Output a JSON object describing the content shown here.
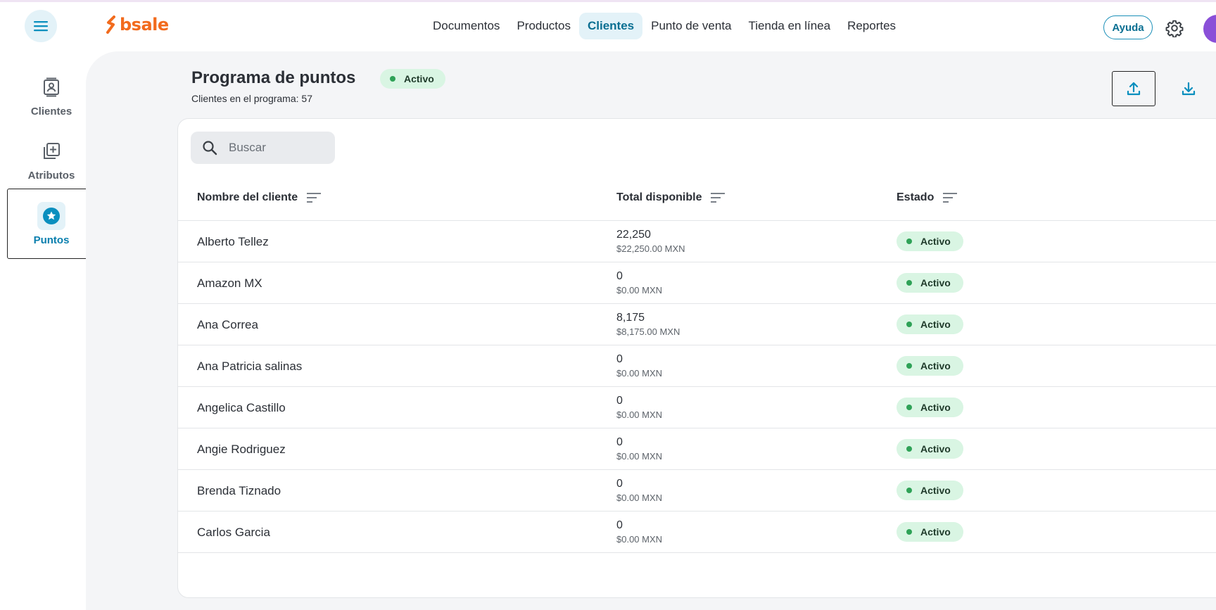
{
  "header": {
    "logo_text": "bsale",
    "nav": [
      {
        "label": "Documentos",
        "active": false
      },
      {
        "label": "Productos",
        "active": false
      },
      {
        "label": "Clientes",
        "active": true
      },
      {
        "label": "Punto de venta",
        "active": false
      },
      {
        "label": "Tienda en línea",
        "active": false
      },
      {
        "label": "Reportes",
        "active": false
      }
    ],
    "help_label": "Ayuda"
  },
  "sidebar": {
    "items": [
      {
        "label": "Clientes",
        "icon": "contact-card-icon",
        "active": false
      },
      {
        "label": "Atributos",
        "icon": "add-library-icon",
        "active": false
      },
      {
        "label": "Puntos",
        "icon": "star-icon",
        "active": true
      }
    ]
  },
  "page": {
    "title": "Programa de puntos",
    "status_badge": "Activo",
    "subtitle": "Clientes en el programa: 57"
  },
  "search": {
    "placeholder": "Buscar"
  },
  "table": {
    "columns": [
      "Nombre del cliente",
      "Total disponible",
      "Estado"
    ],
    "rows": [
      {
        "name": "Alberto Tellez",
        "points": "22,250",
        "money": "$22,250.00 MXN",
        "status": "Activo"
      },
      {
        "name": "Amazon MX",
        "points": "0",
        "money": "$0.00 MXN",
        "status": "Activo"
      },
      {
        "name": "Ana Correa",
        "points": "8,175",
        "money": "$8,175.00 MXN",
        "status": "Activo"
      },
      {
        "name": "Ana Patricia salinas",
        "points": "0",
        "money": "$0.00 MXN",
        "status": "Activo"
      },
      {
        "name": "Angelica Castillo",
        "points": "0",
        "money": "$0.00 MXN",
        "status": "Activo"
      },
      {
        "name": "Angie Rodriguez",
        "points": "0",
        "money": "$0.00 MXN",
        "status": "Activo"
      },
      {
        "name": "Brenda Tiznado",
        "points": "0",
        "money": "$0.00 MXN",
        "status": "Activo"
      },
      {
        "name": "Carlos Garcia",
        "points": "0",
        "money": "$0.00 MXN",
        "status": "Activo"
      }
    ]
  },
  "colors": {
    "accent": "#0a8fbe",
    "brand": "#f26b1d",
    "status_bg": "#d9f5e3",
    "status_dot": "#2fa257",
    "active_nav_bg": "#e3f2f8"
  }
}
